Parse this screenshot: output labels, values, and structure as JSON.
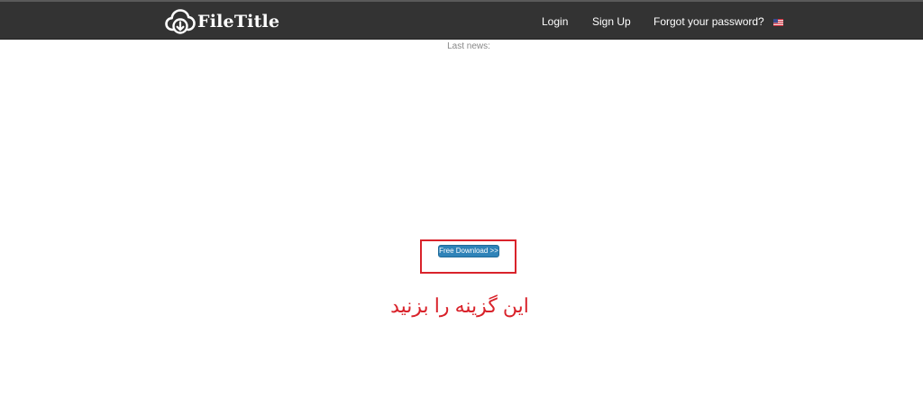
{
  "header": {
    "brand": "FileTitle",
    "brand_icon": "cloud-download-icon",
    "nav": {
      "login": "Login",
      "signup": "Sign Up",
      "forgot_password": "Forgot your password?"
    },
    "language_flag": "us-flag-icon"
  },
  "main": {
    "last_news_label": "Last news:",
    "download_button": "Free Download >>",
    "instruction_text": "این گزینه را بزنید"
  },
  "colors": {
    "navbar_bg": "#333333",
    "button_bg": "#2f83b8",
    "highlight_red": "#d9232b",
    "muted_text": "#888888"
  }
}
